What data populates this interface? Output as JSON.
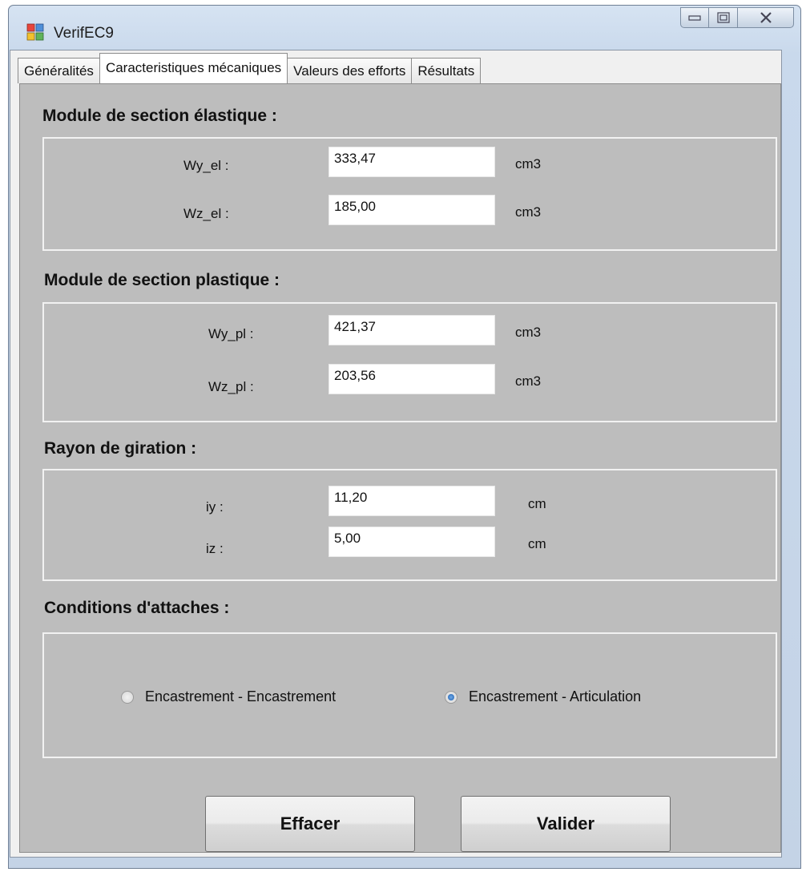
{
  "window": {
    "title": "VerifEC9"
  },
  "tabs": [
    {
      "label": "Généralités"
    },
    {
      "label": "Caracteristiques mécaniques"
    },
    {
      "label": "Valeurs des efforts"
    },
    {
      "label": "Résultats"
    }
  ],
  "sections": {
    "elastique": {
      "heading": "Module de section élastique :",
      "rows": [
        {
          "label": "Wy_el :",
          "value": "333,47",
          "unit": "cm3"
        },
        {
          "label": "Wz_el :",
          "value": "185,00",
          "unit": "cm3"
        }
      ]
    },
    "plastique": {
      "heading": "Module de section plastique :",
      "rows": [
        {
          "label": "Wy_pl :",
          "value": "421,37",
          "unit": "cm3"
        },
        {
          "label": "Wz_pl :",
          "value": "203,56",
          "unit": "cm3"
        }
      ]
    },
    "giration": {
      "heading": "Rayon de giration :",
      "rows": [
        {
          "label": "iy :",
          "value": "11,20",
          "unit": "cm"
        },
        {
          "label": "iz :",
          "value": "5,00",
          "unit": "cm"
        }
      ]
    },
    "attaches": {
      "heading": "Conditions d'attaches :",
      "options": [
        {
          "label": "Encastrement - Encastrement",
          "selected": false
        },
        {
          "label": "Encastrement - Articulation",
          "selected": true
        }
      ]
    }
  },
  "buttons": {
    "clear": "Effacer",
    "validate": "Valider"
  }
}
